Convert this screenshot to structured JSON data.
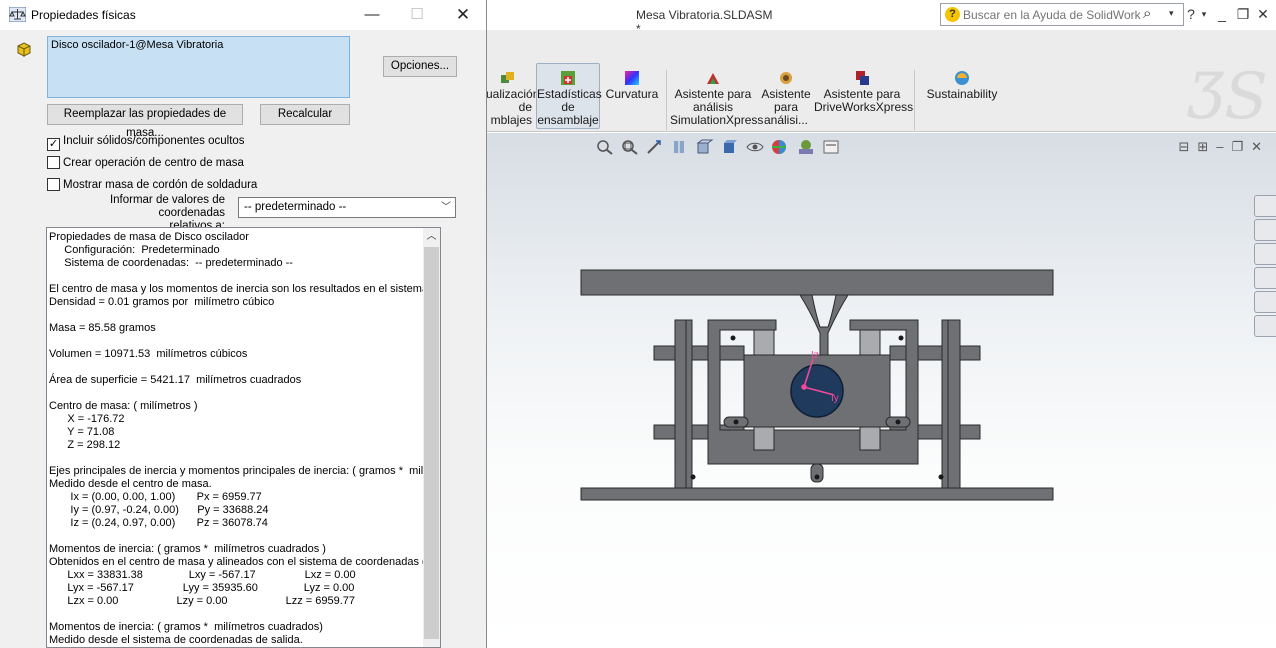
{
  "dialog": {
    "title": "Propiedades físicas",
    "selection": "Disco oscilador-1@Mesa Vibratoria",
    "options_button": "Opciones...",
    "override_button": "Reemplazar las propiedades de masa...",
    "recalc_button": "Recalcular",
    "checkboxes": [
      {
        "label": "Incluir sólidos/componentes ocultos",
        "checked": true
      },
      {
        "label": "Crear operación de centro de masa",
        "checked": false
      },
      {
        "label": "Mostrar masa de cordón de soldadura",
        "checked": false
      }
    ],
    "relative_label_1": "Informar de valores de coordenadas",
    "relative_label_2": "relativos a:",
    "relative_value": "-- predeterminado --",
    "results": [
      "Propiedades de masa de Disco oscilador",
      "     Configuración:  Predeterminado",
      "     Sistema de coordenadas:  -- predeterminado --",
      "",
      "El centro de masa y los momentos de inercia son los resultados en el sistema de",
      "Densidad = 0.01 gramos por  milímetro cúbico",
      "",
      "Masa = 85.58 gramos",
      "",
      "Volumen = 10971.53  milímetros cúbicos",
      "",
      "Área de superficie = 5421.17  milímetros cuadrados",
      "",
      "Centro de masa: ( milímetros )",
      "      X = -176.72",
      "      Y = 71.08",
      "      Z = 298.12",
      "",
      "Ejes principales de inercia y momentos principales de inercia: ( gramos *  milímetros",
      "Medido desde el centro de masa.",
      "       Ix = (0.00, 0.00, 1.00)       Px = 6959.77",
      "       Iy = (0.97, -0.24, 0.00)      Py = 33688.24",
      "       Iz = (0.24, 0.97, 0.00)       Pz = 36078.74",
      "",
      "Momentos de inercia: ( gramos *  milímetros cuadrados )",
      "Obtenidos en el centro de masa y alineados con el sistema de coordenadas de",
      "      Lxx = 33831.38               Lxy = -567.17                Lxz = 0.00",
      "      Lyx = -567.17                Lyy = 35935.60               Lyz = 0.00",
      "      Lzx = 0.00                   Lzy = 0.00                   Lzz = 6959.77",
      "",
      "Momentos de inercia: ( gramos *  milímetros cuadrados)",
      "Medido desde el sistema de coordenadas de salida."
    ]
  },
  "app": {
    "title": "Mesa Vibratoria.SLDASM *",
    "help_placeholder": "Buscar en la Ayuda de SolidWorks",
    "ribbon": [
      {
        "label": "ualización\nde\nmblajes"
      },
      {
        "label": "Estadísticas\nde\nensamblaje",
        "selected": true
      },
      {
        "label": "Curvatura"
      },
      {
        "label": "Asistente para\nanálisis\nSimulationXpress"
      },
      {
        "label": "Asistente\npara\nanálisi..."
      },
      {
        "label": "Asistente para\nDriveWorksXpress"
      },
      {
        "label": "Sustainability"
      }
    ],
    "triad": {
      "y_label": "Iy",
      "z_label": "Iz"
    }
  }
}
